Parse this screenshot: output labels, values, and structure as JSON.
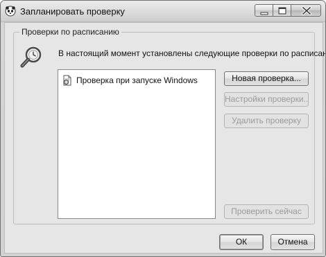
{
  "window": {
    "title": "Запланировать проверку"
  },
  "group": {
    "legend": "Проверки по расписанию",
    "description": "В настоящий момент установлены следующие проверки по расписанию."
  },
  "scheduled_checks": [
    {
      "label": "Проверка при запуске Windows",
      "icon": "document-gear-icon"
    }
  ],
  "actions": {
    "new_check": "Новая проверка...",
    "check_settings": "Настройки проверки...",
    "delete_check": "Удалить проверку",
    "check_now": "Проверить сейчас"
  },
  "footer": {
    "ok": "ОК",
    "cancel": "Отмена"
  },
  "icons": {
    "app": "panda-icon",
    "group": "magnifier-clock-icon",
    "minimize": "minimize-icon",
    "maximize": "maximize-icon",
    "close": "close-icon"
  }
}
